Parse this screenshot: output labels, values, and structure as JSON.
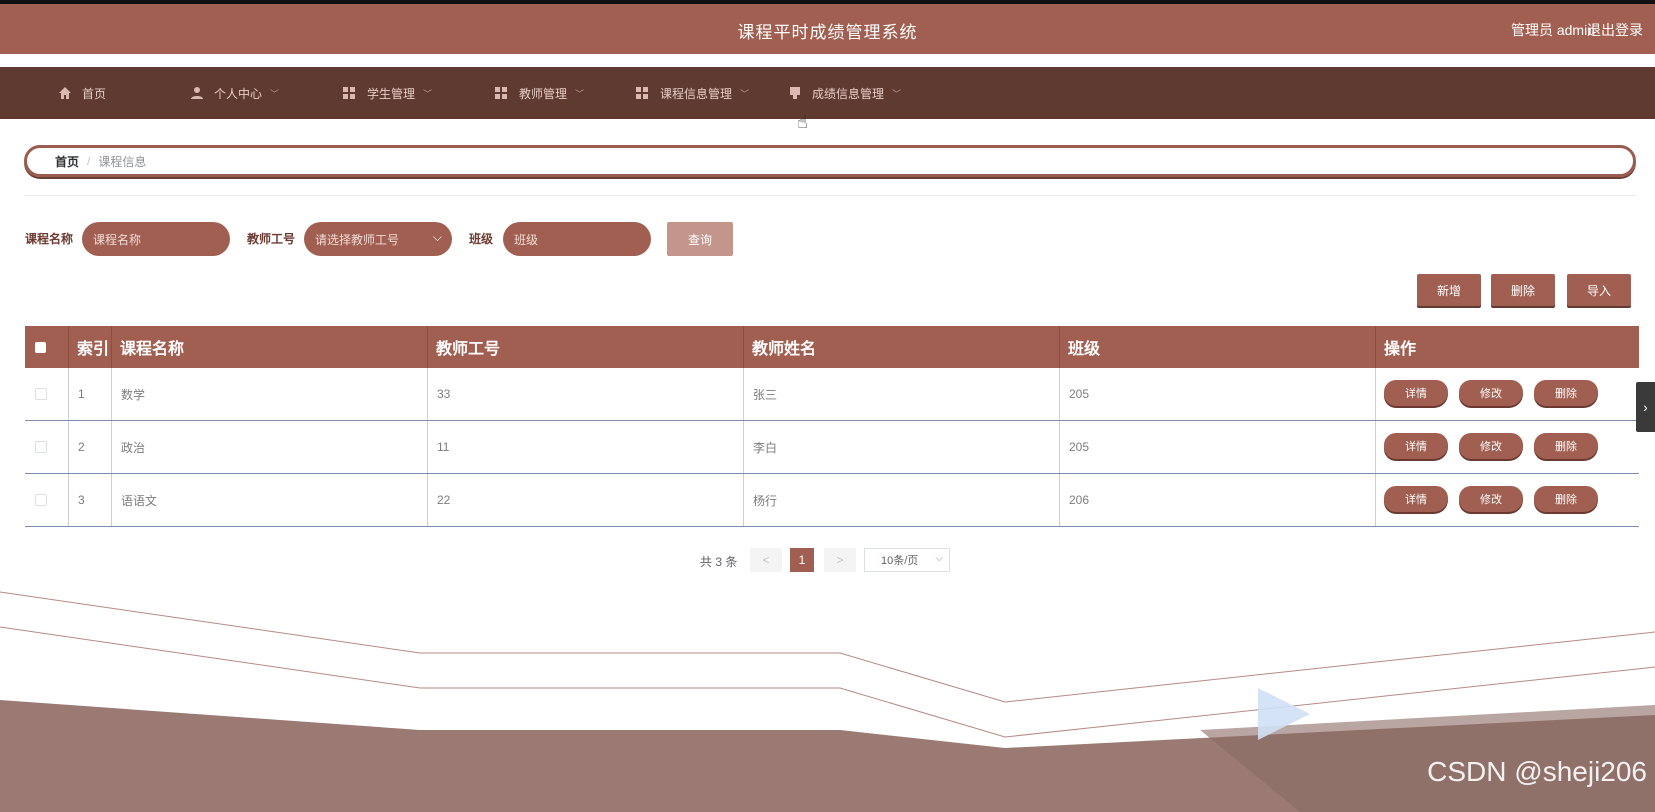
{
  "header": {
    "title": "课程平时成绩管理系统",
    "user": "管理员 admin",
    "logout": "退出登录"
  },
  "nav": [
    {
      "label": "首页",
      "icon": "home-icon"
    },
    {
      "label": "个人中心",
      "icon": "user-icon"
    },
    {
      "label": "学生管理",
      "icon": "grid-icon"
    },
    {
      "label": "教师管理",
      "icon": "grid-icon"
    },
    {
      "label": "课程信息管理",
      "icon": "grid-icon"
    },
    {
      "label": "成绩信息管理",
      "icon": "doc-icon"
    }
  ],
  "breadcrumb": {
    "home": "首页",
    "separator": "/",
    "current": "课程信息"
  },
  "filters": {
    "course_name_label": "课程名称",
    "course_name_placeholder": "课程名称",
    "teacher_no_label": "教师工号",
    "teacher_no_placeholder": "请选择教师工号",
    "class_label": "班级",
    "class_placeholder": "班级",
    "query_label": "查询"
  },
  "actions": {
    "add": "新增",
    "delete": "删除",
    "import": "导入"
  },
  "table": {
    "headers": [
      "索引",
      "课程名称",
      "教师工号",
      "教师姓名",
      "班级",
      "操作"
    ],
    "rows": [
      {
        "index": "1",
        "course": "数学",
        "teacher_no": "33",
        "teacher_name": "张三",
        "class": "205"
      },
      {
        "index": "2",
        "course": "政治",
        "teacher_no": "11",
        "teacher_name": "李白",
        "class": "205"
      },
      {
        "index": "3",
        "course": "语语文",
        "teacher_no": "22",
        "teacher_name": "杨行",
        "class": "206"
      }
    ],
    "row_actions": {
      "detail": "详情",
      "edit": "修改",
      "delete": "删除"
    }
  },
  "pagination": {
    "total": "共 3 条",
    "prev": "<",
    "current": "1",
    "next": ">",
    "page_size": "10条/页"
  },
  "watermark": "CSDN @sheji206",
  "colors": {
    "primary": "#a15f52",
    "nav_bg": "#5e3a31",
    "accent_light": "#c4958b"
  }
}
